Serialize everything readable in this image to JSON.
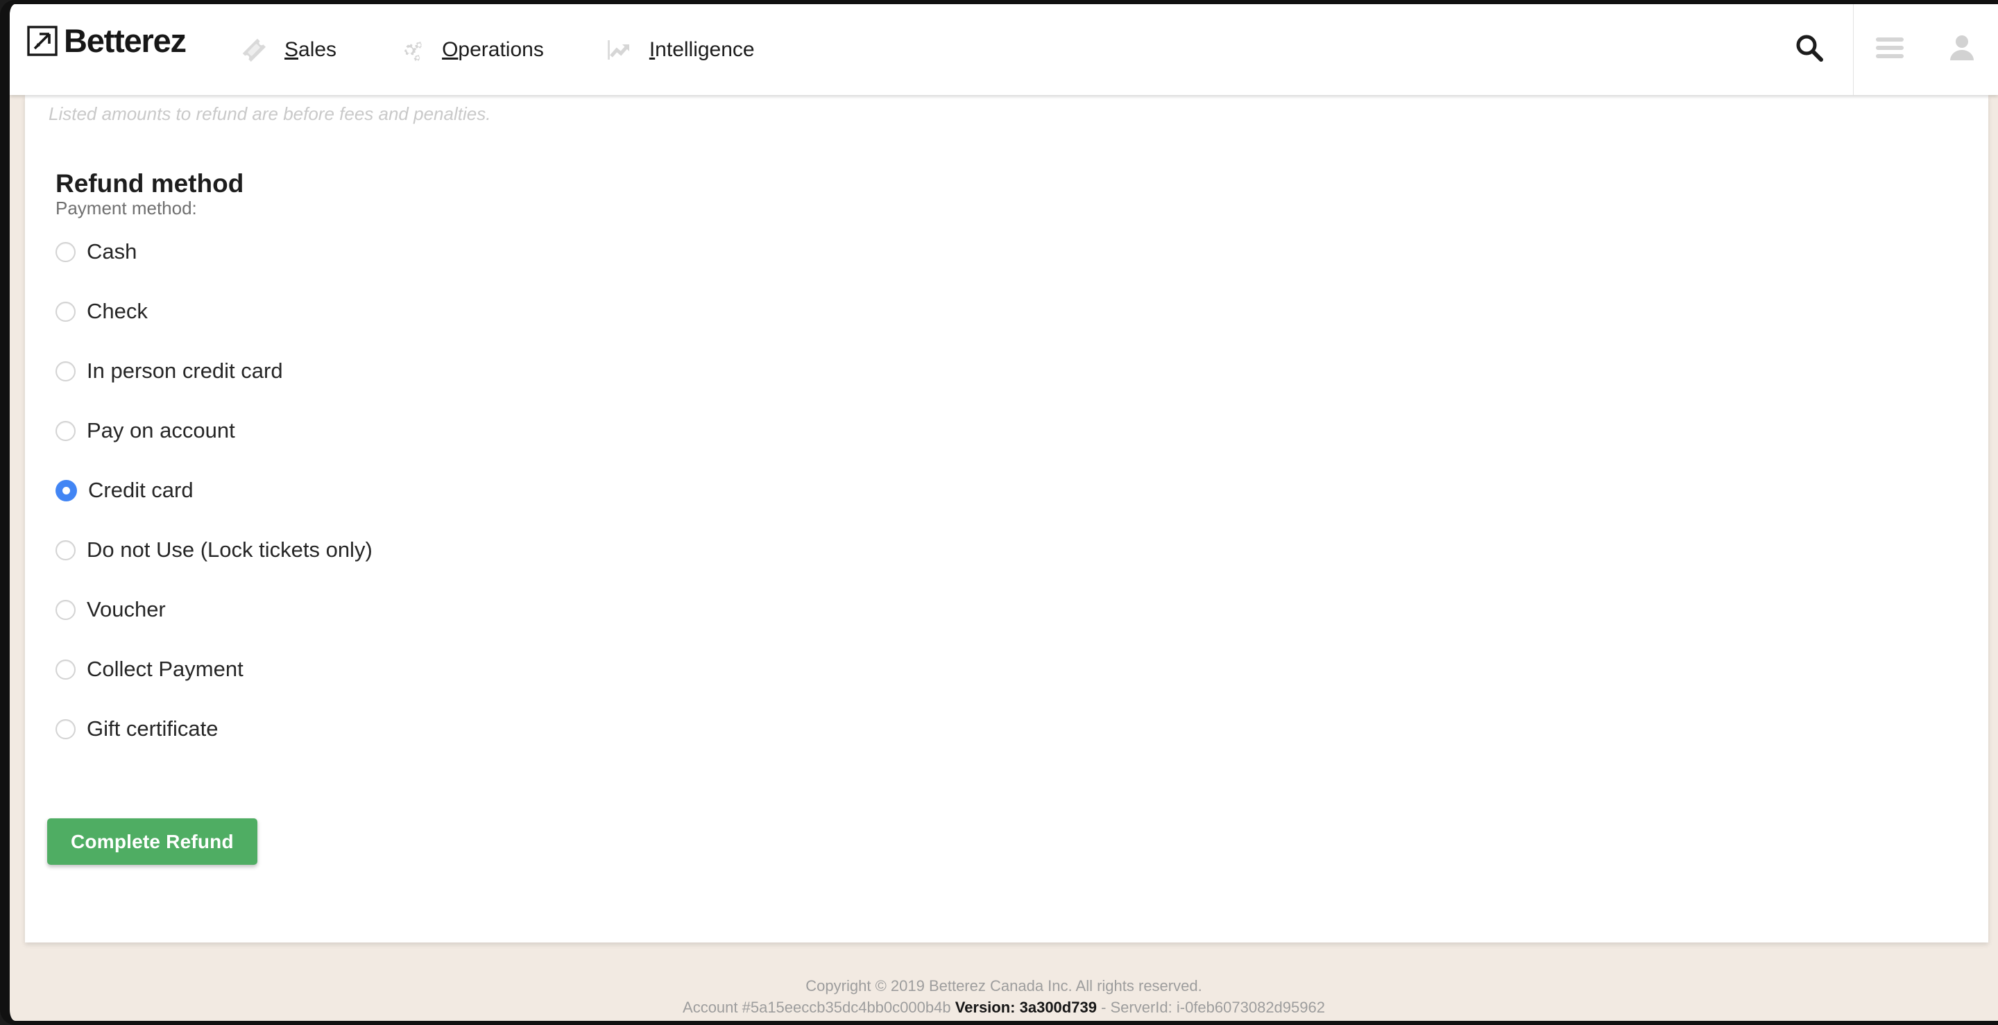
{
  "header": {
    "brand": {
      "name": "Betterez",
      "logo_icon": "arrow-up-right-square-icon"
    },
    "nav": [
      {
        "label_prefix": "",
        "accesskey": "S",
        "label_rest": "ales",
        "icon": "ticket-icon",
        "name": "nav-sales"
      },
      {
        "label_prefix": "",
        "accesskey": "O",
        "label_rest": "perations",
        "icon": "gears-icon",
        "name": "nav-operations"
      },
      {
        "label_prefix": "",
        "accesskey": "I",
        "label_rest": "ntelligence",
        "icon": "line-chart-icon",
        "name": "nav-intelligence"
      }
    ],
    "actions": {
      "search_icon": "search-icon",
      "menu_icon": "hamburger-menu-icon",
      "account_icon": "user-avatar-icon"
    }
  },
  "main": {
    "note": "Listed amounts to refund are before fees and penalties.",
    "section_title": "Refund method",
    "field_label": "Payment method:",
    "payment_methods": [
      {
        "label": "Cash",
        "checked": false
      },
      {
        "label": "Check",
        "checked": false
      },
      {
        "label": "In person credit card",
        "checked": false
      },
      {
        "label": "Pay on account",
        "checked": false
      },
      {
        "label": "Credit card",
        "checked": true
      },
      {
        "label": "Do not Use (Lock tickets only)",
        "checked": false
      },
      {
        "label": "Voucher",
        "checked": false
      },
      {
        "label": "Collect Payment",
        "checked": false
      },
      {
        "label": "Gift certificate",
        "checked": false
      }
    ],
    "selected_payment_method": "Credit card",
    "submit_label": "Complete Refund"
  },
  "footer": {
    "copyright": "Copyright © 2019 Betterez Canada Inc. All rights reserved.",
    "account": "Account #5a15eeccb35dc4bb0c000b4b",
    "version_label": "Version: 3a300d739",
    "server": "- ServerId: i-0feb6073082d95962"
  },
  "colors": {
    "accent_radio": "#4285f4",
    "submit_green": "#4fad63",
    "page_background": "#f2eae2",
    "card_background": "#ffffff"
  }
}
